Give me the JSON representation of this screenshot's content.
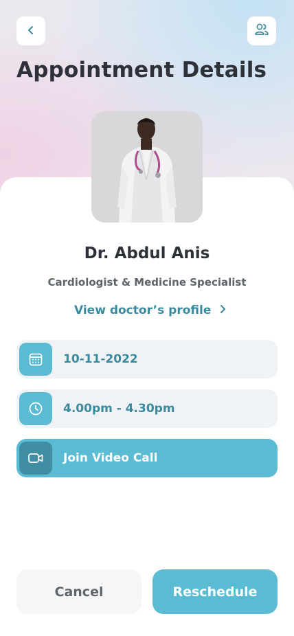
{
  "header": {
    "title": "Appointment Details",
    "back_icon": "chevron-left-icon",
    "users_icon": "users-icon"
  },
  "doctor": {
    "name": "Dr. Abdul Anis",
    "specialty": "Cardiologist & Medicine Specialist",
    "profile_link": "View doctor’s profile",
    "photo_description": "doctor-photo"
  },
  "appointment": {
    "date": "10-11-2022",
    "time": "4.00pm - 4.30pm",
    "video_call": "Join Video Call"
  },
  "actions": {
    "cancel": "Cancel",
    "reschedule": "Reschedule"
  },
  "colors": {
    "accent": "#5bbbd2",
    "accent_dark": "#3f8ea2",
    "link": "#3a8a9e",
    "title": "#2e3238",
    "row_bg": "#f0f3f5"
  }
}
